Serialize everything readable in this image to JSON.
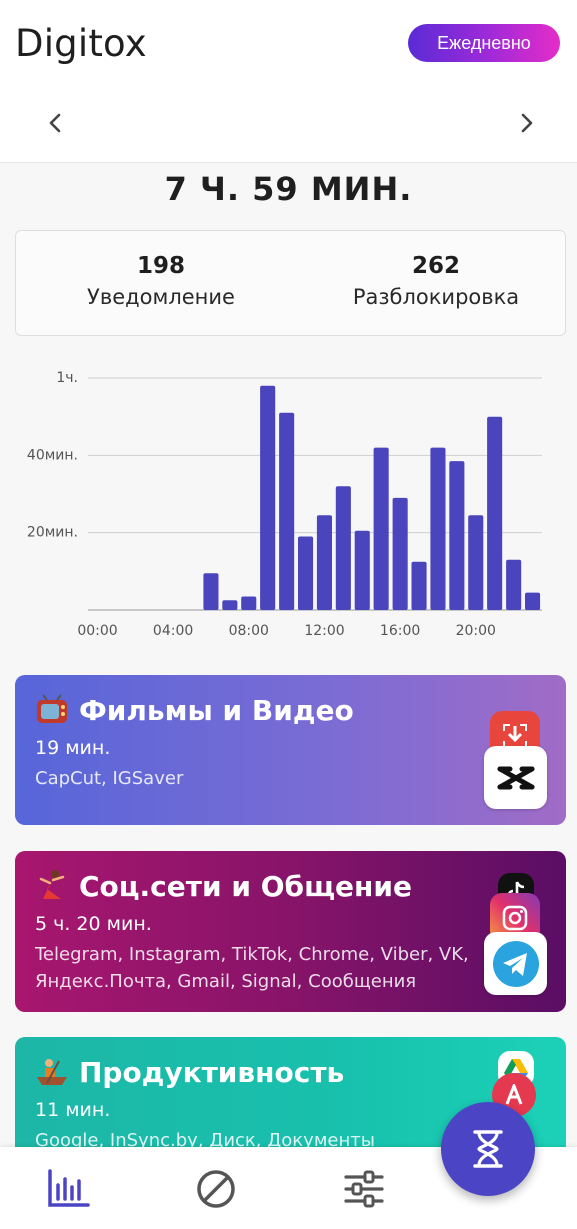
{
  "app": {
    "title": "Digitox",
    "period_button": "Ежедневно"
  },
  "summary": {
    "total_time": "7 Ч. 59 МИН.",
    "notifications_value": "198",
    "notifications_label": "Уведомление",
    "unlocks_value": "262",
    "unlocks_label": "Разблокировка"
  },
  "chart_data": {
    "type": "bar",
    "ytick_labels": [
      "1ч.",
      "40мин.",
      "20мин."
    ],
    "xtick_labels": [
      "00:00",
      "04:00",
      "08:00",
      "12:00",
      "16:00",
      "20:00"
    ],
    "unit": "minutes",
    "ylim": [
      0,
      60
    ],
    "yticks": [
      60,
      40,
      20
    ],
    "grid": true,
    "bar_color": "#4b45bd",
    "categories": [
      "00",
      "01",
      "02",
      "03",
      "04",
      "05",
      "06",
      "07",
      "08",
      "09",
      "10",
      "11",
      "12",
      "13",
      "14",
      "15",
      "16",
      "17",
      "18",
      "19",
      "20",
      "21",
      "22",
      "23"
    ],
    "values": [
      0,
      0,
      0,
      0,
      0,
      0,
      9.5,
      2.5,
      3.5,
      58,
      51,
      19,
      24.5,
      32,
      20.5,
      42,
      29,
      12.5,
      42,
      38.5,
      24.5,
      50,
      13,
      4.5
    ]
  },
  "categories": [
    {
      "emoji": "tv-emoji",
      "title": "Фильмы и Видео",
      "time": "19 мин.",
      "apps": "CapCut, IGSaver"
    },
    {
      "emoji": "dancer-emoji",
      "title": "Соц.сети и Общение",
      "time": "5 ч. 20 мин.",
      "apps": "Telegram, Instagram, TikTok, Chrome, Viber, VK, Яндекс.Почта, Gmail, Signal, Сообщения"
    },
    {
      "emoji": "rowboat-emoji",
      "title": "Продуктивность",
      "time": "11 мин.",
      "apps": "Google, InSync.by, Диск, Документы"
    }
  ],
  "colors": {
    "accent": "#4b45c6",
    "bar": "#4b45bd"
  }
}
